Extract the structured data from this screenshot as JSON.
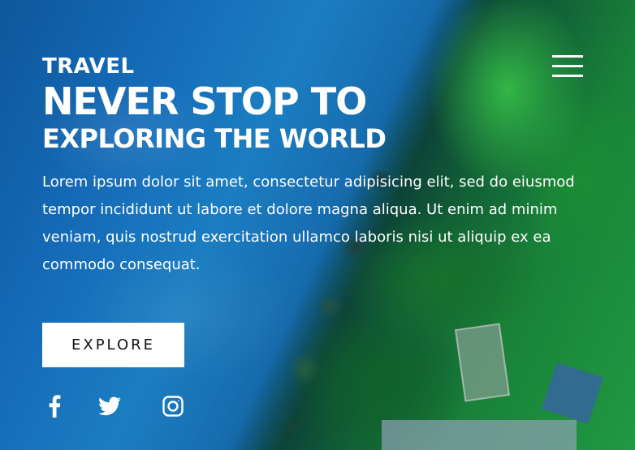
{
  "hero": {
    "eyebrow": "TRAVEL",
    "headline": "NEVER STOP TO",
    "subheadline": "EXPLORING THE WORLD",
    "body": "Lorem ipsum dolor sit amet, consectetur adipisicing elit, sed do eiusmod tempor incididunt ut labore et dolore magna aliqua. Ut enim ad minim veniam, quis nostrud exercitation ullamco laboris nisi ut aliquip ex ea commodo consequat.",
    "button_label": "EXPLORE"
  },
  "social": {
    "icons": [
      "facebook-icon",
      "twitter-icon",
      "instagram-icon"
    ]
  },
  "menu": {
    "icon": "hamburger-menu-icon"
  },
  "colors": {
    "text": "#ffffff",
    "button_bg": "#ffffff",
    "button_text": "#111111"
  }
}
